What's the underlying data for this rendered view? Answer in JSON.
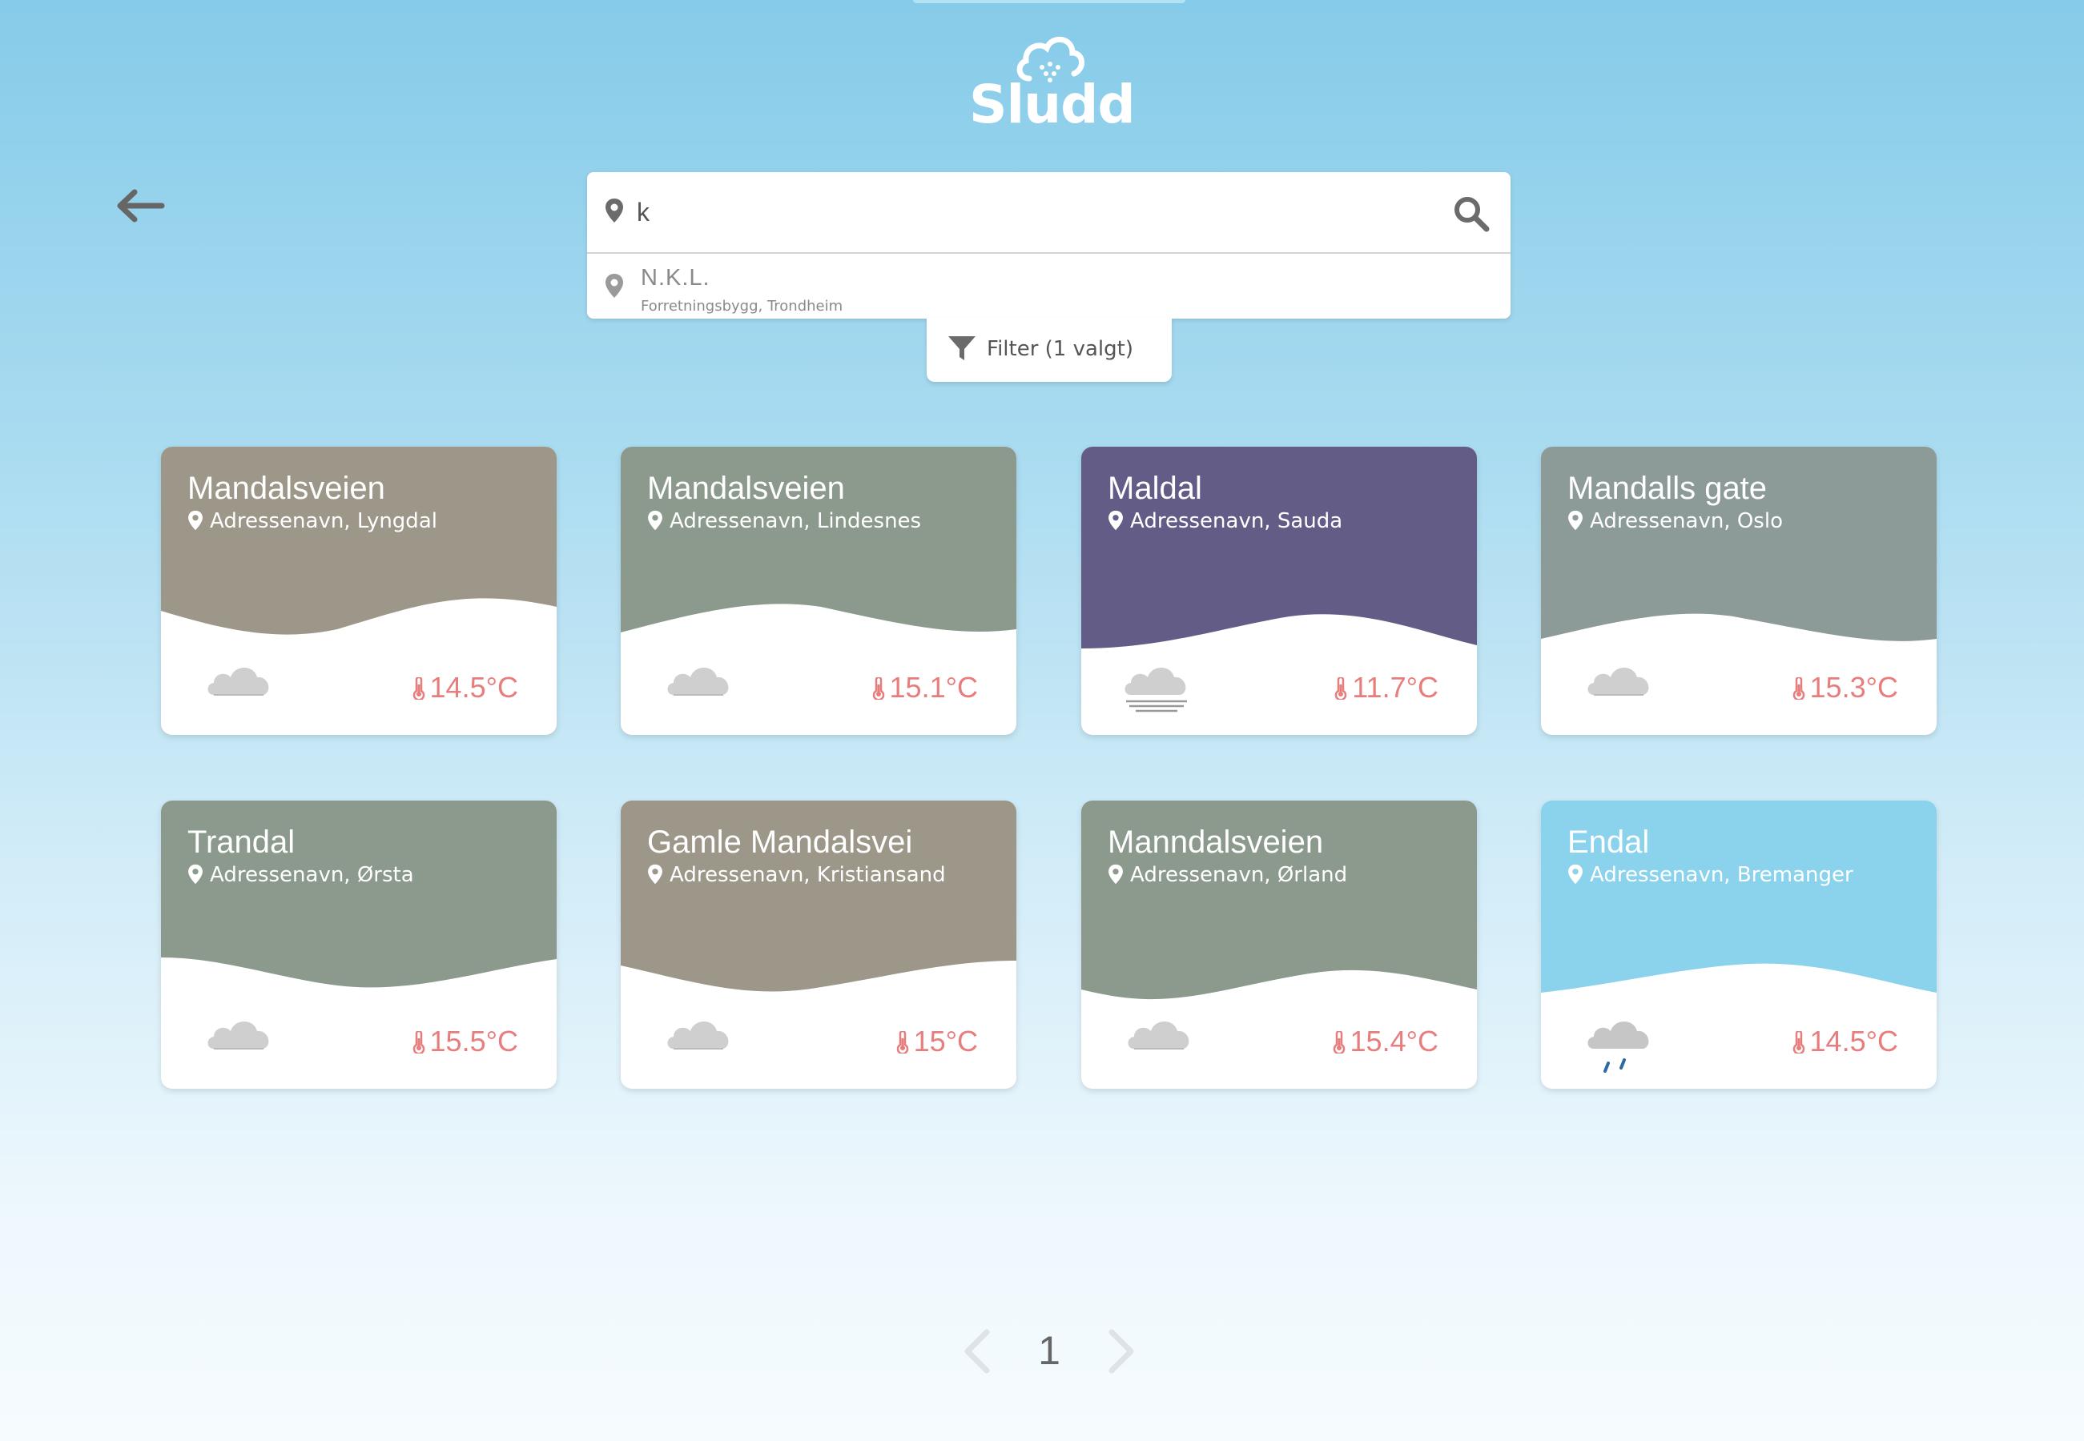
{
  "app": {
    "logo_text": "Sludd"
  },
  "search": {
    "value": "k",
    "suggestion": {
      "title": "N.K.L.",
      "subtitle": "Forretningsbygg, Trondheim"
    }
  },
  "filter": {
    "label": "Filter (1 valgt)"
  },
  "cards": [
    {
      "name": "Mandalsveien",
      "address": "Adressenavn, Lyngdal",
      "temp": "14.5°C",
      "weather": "cloud-icon",
      "color": "#9d978a"
    },
    {
      "name": "Mandalsveien",
      "address": "Adressenavn, Lindesnes",
      "temp": "15.1°C",
      "weather": "cloud-icon",
      "color": "#8c9a8d"
    },
    {
      "name": "Maldal",
      "address": "Adressenavn, Sauda",
      "temp": "11.7°C",
      "weather": "fog-icon",
      "color": "#625c86"
    },
    {
      "name": "Mandalls gate",
      "address": "Adressenavn, Oslo",
      "temp": "15.3°C",
      "weather": "cloud-icon",
      "color": "#8c9a98"
    },
    {
      "name": "Trandal",
      "address": "Adressenavn, Ørsta",
      "temp": "15.5°C",
      "weather": "cloud-icon",
      "color": "#8c9a8d"
    },
    {
      "name": "Gamle Mandalsvei",
      "address": "Adressenavn, Kristiansand",
      "temp": "15°C",
      "weather": "cloud-icon",
      "color": "#9d978a"
    },
    {
      "name": "Manndalsveien",
      "address": "Adressenavn, Ørland",
      "temp": "15.4°C",
      "weather": "cloud-icon",
      "color": "#8c9a8d"
    },
    {
      "name": "Endal",
      "address": "Adressenavn, Bremanger",
      "temp": "14.5°C",
      "weather": "rain-icon",
      "color": "#8bd2ec"
    }
  ],
  "pagination": {
    "current_page": "1"
  },
  "colors": {
    "temp": "#e87d7d",
    "icon_gray": "#6b6b6b"
  }
}
